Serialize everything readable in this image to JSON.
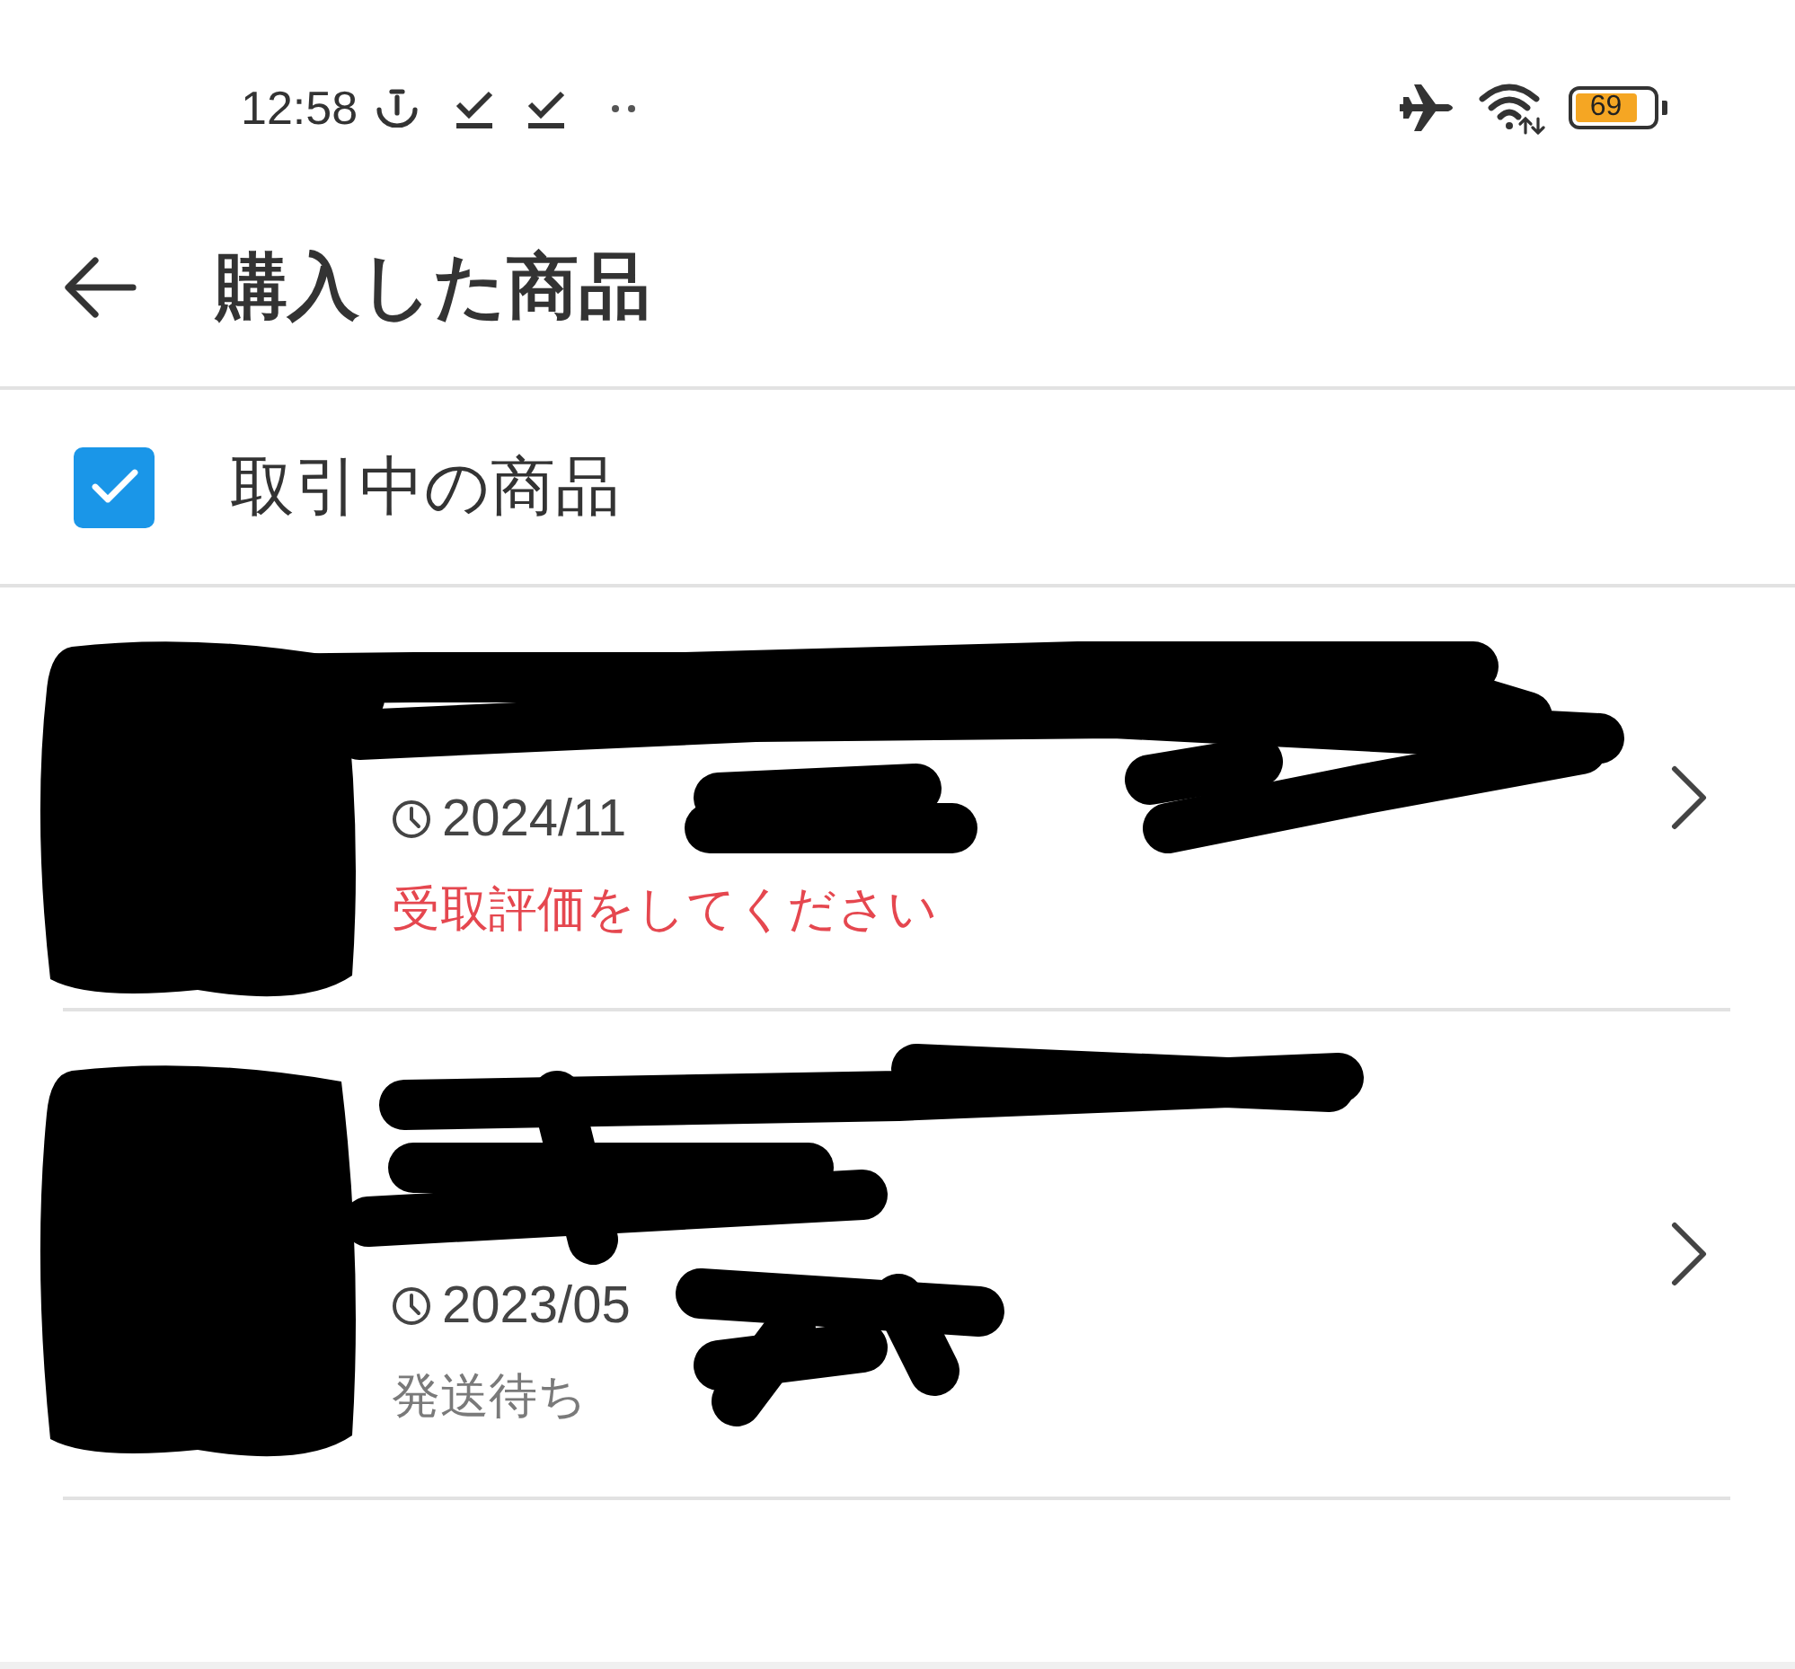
{
  "status_bar": {
    "time": "12:58",
    "battery": "69"
  },
  "header": {
    "title": "購入した商品"
  },
  "filter": {
    "label": "取引中の商品",
    "checked": true
  },
  "items": [
    {
      "kind": "alert",
      "date": "2024/11",
      "status": "受取評価をしてください"
    },
    {
      "kind": "normal",
      "date": "2023/05",
      "status": "発送待ち"
    }
  ]
}
